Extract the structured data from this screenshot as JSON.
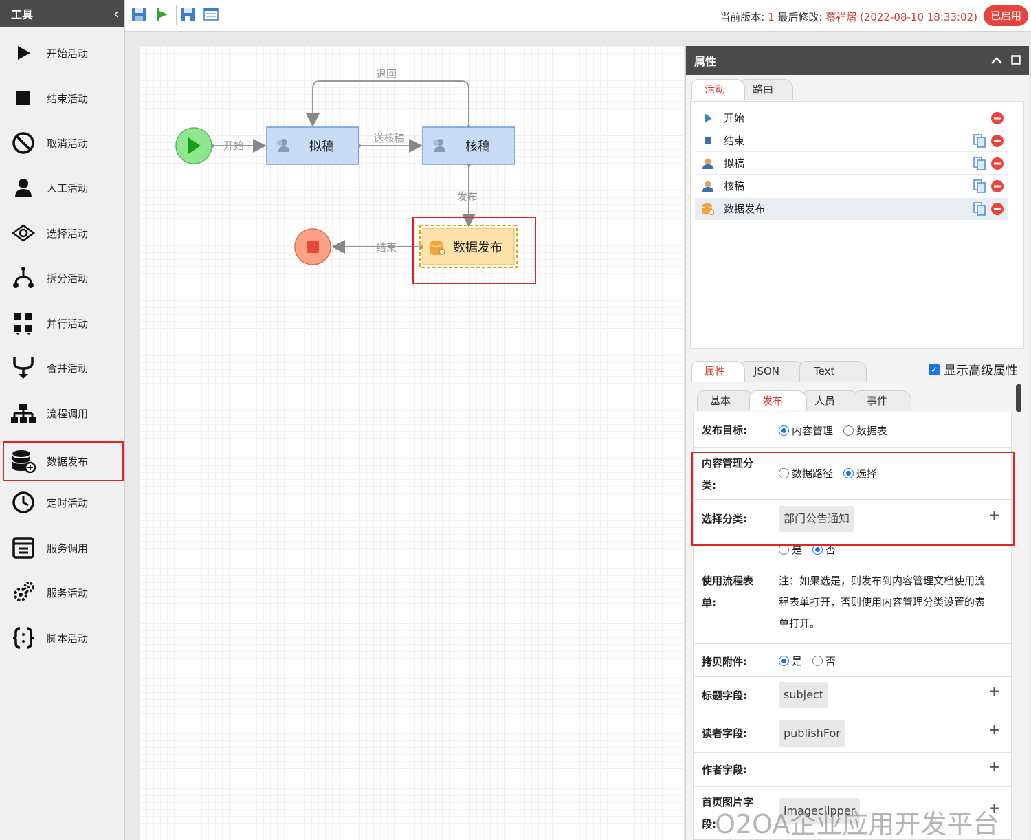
{
  "tool_panel": {
    "title": "工具",
    "items": [
      {
        "label": "开始活动",
        "icon": "play-icon"
      },
      {
        "label": "结束活动",
        "icon": "stop-icon"
      },
      {
        "label": "取消活动",
        "icon": "cancel-icon"
      },
      {
        "label": "人工活动",
        "icon": "person-icon"
      },
      {
        "label": "选择活动",
        "icon": "choice-icon"
      },
      {
        "label": "拆分活动",
        "icon": "split-icon"
      },
      {
        "label": "并行活动",
        "icon": "parallel-icon"
      },
      {
        "label": "合并活动",
        "icon": "merge-icon"
      },
      {
        "label": "流程调用",
        "icon": "subprocess-icon"
      },
      {
        "label": "数据发布",
        "icon": "database-icon"
      },
      {
        "label": "定时活动",
        "icon": "clock-icon"
      },
      {
        "label": "服务调用",
        "icon": "service-call-icon"
      },
      {
        "label": "服务活动",
        "icon": "gears-icon"
      },
      {
        "label": "脚本活动",
        "icon": "script-icon"
      }
    ]
  },
  "top_bar": {
    "version_prefix": "当前版本: ",
    "version": "1",
    "modified_prefix": " 最后修改: ",
    "modified_by": "蔡祥熠 (2022-08-10 18:33:02)",
    "status": "已启用"
  },
  "flow": {
    "start_edge_label": "开始",
    "draft_node": "拟稿",
    "review_node": "核稿",
    "return_edge_label": "退回",
    "send_review_edge_label": "送核稿",
    "publish_edge_label": "发布",
    "publish_node": "数据发布",
    "end_edge_label": "结束"
  },
  "prop_panel": {
    "title": "属性",
    "top_tabs": [
      "活动",
      "路由"
    ],
    "activities": [
      {
        "label": "开始",
        "icon": "start-triangle-icon"
      },
      {
        "label": "结束",
        "icon": "end-square-icon"
      },
      {
        "label": "拟稿",
        "icon": "user-icon"
      },
      {
        "label": "核稿",
        "icon": "user-icon"
      },
      {
        "label": "数据发布",
        "icon": "database-icon"
      }
    ],
    "bottom_tabs": [
      "属性",
      "JSON",
      "Text"
    ],
    "advanced_label": "显示高级属性",
    "sub_tabs": [
      "基本",
      "发布",
      "人员",
      "事件"
    ],
    "form": {
      "target_label": "发布目标:",
      "target_opt1": "内容管理",
      "target_opt2": "数据表",
      "category_label_1": "内容管理分",
      "category_label_2": "类:",
      "category_opt1": "数据路径",
      "category_opt2": "选择",
      "select_label": "选择分类:",
      "select_value": "部门公告通知",
      "use_form_opt1": "是",
      "use_form_opt2": "否",
      "use_form_label_1": "使用流程表",
      "use_form_label_2": "单:",
      "use_form_note_1": "注：如果选是，则发布到内容管理文档使用流",
      "use_form_note_2": "程表单打开，否则使用内容管理分类设置的表",
      "use_form_note_3": "单打开。",
      "copy_attach_label": "拷贝附件:",
      "copy_opt1": "是",
      "copy_opt2": "否",
      "title_field_label": "标题字段:",
      "title_field_value": "subject",
      "reader_field_label": "读者字段:",
      "reader_field_value": "publishFor",
      "author_field_label": "作者字段:",
      "image_field_label_1": "首页图片字",
      "image_field_label_2": "段:",
      "image_field_value": "imageclipper"
    }
  },
  "watermark": "O2OA企业应用开发平台"
}
